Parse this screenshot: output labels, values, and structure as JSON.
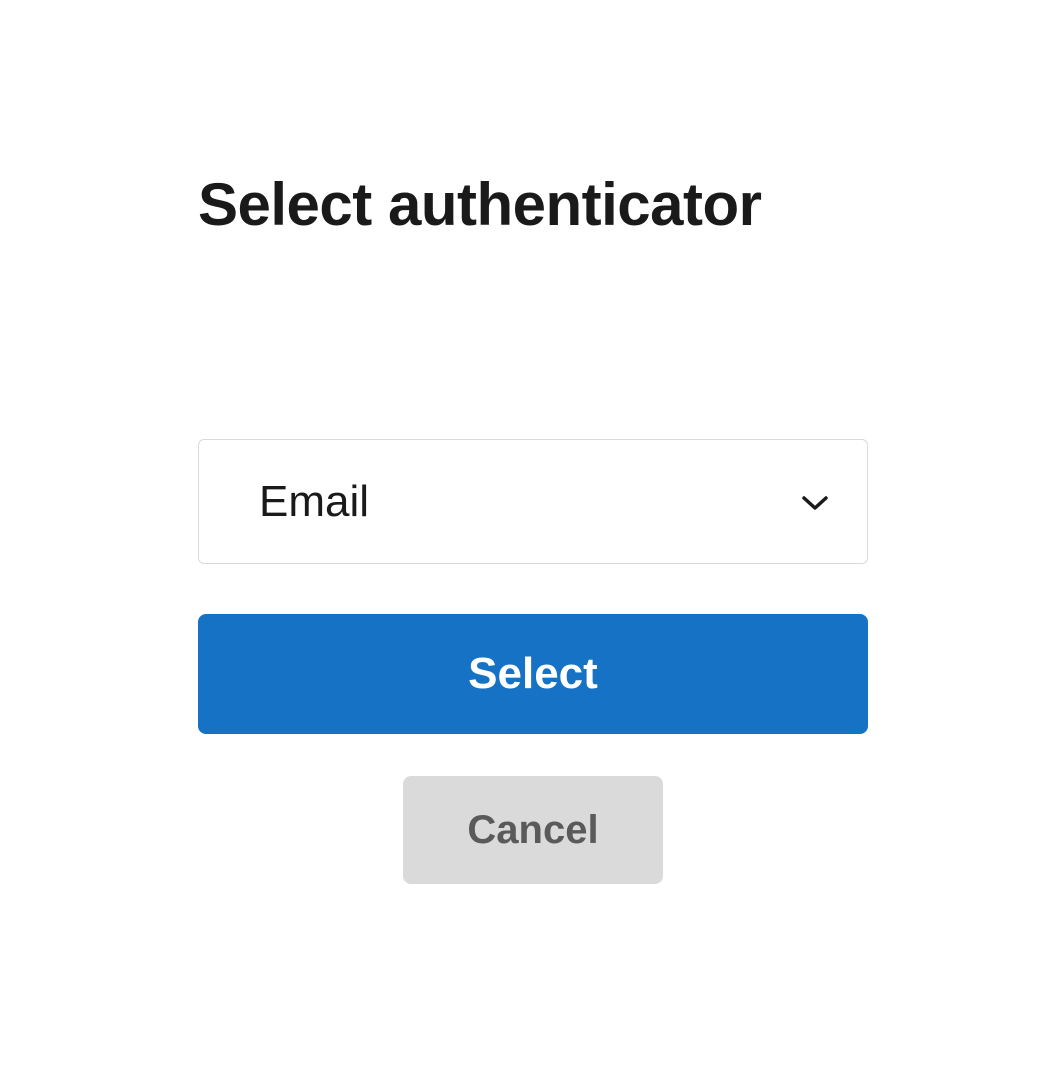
{
  "title": "Select authenticator",
  "dropdown": {
    "selected": "Email"
  },
  "buttons": {
    "select": "Select",
    "cancel": "Cancel"
  }
}
